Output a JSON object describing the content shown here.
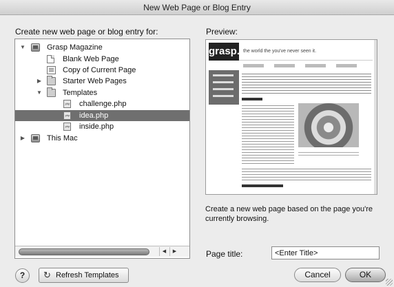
{
  "window": {
    "title": "New Web Page or Blog Entry"
  },
  "left_panel": {
    "heading": "Create new web page or blog entry for:",
    "tree": [
      {
        "label": "Grasp Magazine",
        "icon": "computer-icon",
        "expanded": true
      },
      {
        "label": "Blank Web Page",
        "icon": "blank-page-icon"
      },
      {
        "label": "Copy of Current Page",
        "icon": "copy-page-icon"
      },
      {
        "label": "Starter Web Pages",
        "icon": "folder-icon",
        "expanded": false
      },
      {
        "label": "Templates",
        "icon": "folder-icon",
        "expanded": true
      },
      {
        "label": "challenge.php",
        "icon": "php-file-icon"
      },
      {
        "label": "idea.php",
        "icon": "php-file-icon",
        "selected": true
      },
      {
        "label": "inside.php",
        "icon": "php-file-icon"
      },
      {
        "label": "This Mac",
        "icon": "computer-icon",
        "expanded": false
      }
    ]
  },
  "preview": {
    "heading": "Preview:",
    "logo": "grasp.",
    "tagline": "the world the you've never seen it."
  },
  "description": "Create a new web page based on the page you're currently browsing.",
  "page_title": {
    "label": "Page title:",
    "value": "<Enter Title>"
  },
  "buttons": {
    "help": "?",
    "refresh": "Refresh Templates",
    "cancel": "Cancel",
    "ok": "OK"
  },
  "colors": {
    "selection": "#6f6f6f",
    "preview_header": "#222222",
    "preview_nav": "#6c6c6c"
  }
}
